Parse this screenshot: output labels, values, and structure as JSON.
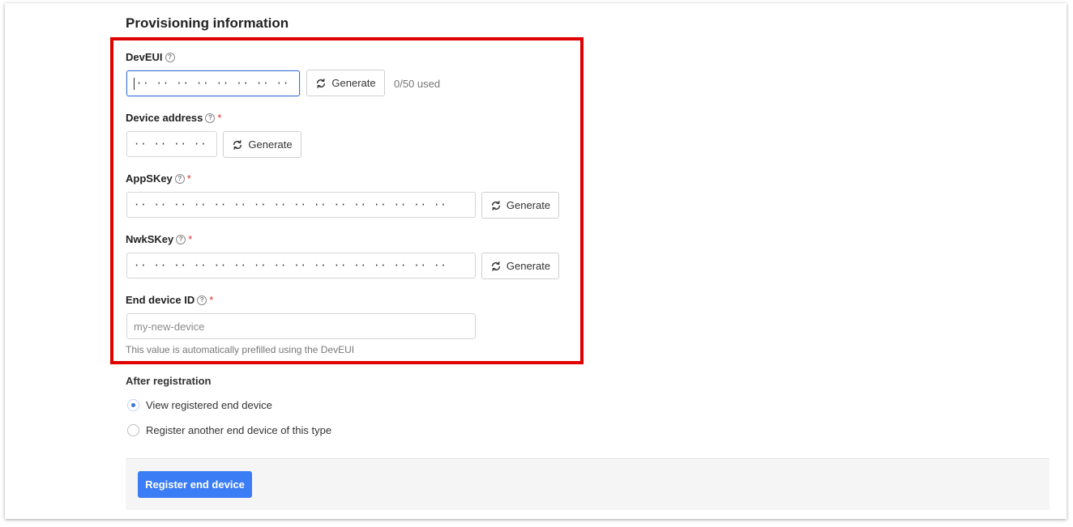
{
  "section": {
    "title": "Provisioning information"
  },
  "fields": {
    "deveui": {
      "label": "DevEUI",
      "value": "·· ·· ·· ·· ·· ·· ·· ··",
      "generate_label": "Generate",
      "usage": "0/50 used"
    },
    "device_address": {
      "label": "Device address",
      "required_mark": "*",
      "value": "·· ·· ·· ··",
      "generate_label": "Generate"
    },
    "appskey": {
      "label": "AppSKey",
      "required_mark": "*",
      "value": "·· ·· ·· ·· ·· ·· ·· ·· ·· ·· ·· ·· ·· ·· ·· ··",
      "generate_label": "Generate"
    },
    "nwkskey": {
      "label": "NwkSKey",
      "required_mark": "*",
      "value": "·· ·· ·· ·· ·· ·· ·· ·· ·· ·· ·· ·· ·· ·· ·· ··",
      "generate_label": "Generate"
    },
    "end_device_id": {
      "label": "End device ID",
      "required_mark": "*",
      "placeholder": "my-new-device",
      "helper": "This value is automatically prefilled using the DevEUI"
    }
  },
  "after_registration": {
    "label": "After registration",
    "options": [
      {
        "label": "View registered end device",
        "checked": true
      },
      {
        "label": "Register another end device of this type",
        "checked": false
      }
    ]
  },
  "submit": {
    "label": "Register end device"
  },
  "colors": {
    "highlight": "#e00000",
    "primary": "#3b7df4",
    "required": "#e0312a",
    "focus": "#3b74d6"
  },
  "icons": {
    "help": "question-circle-icon",
    "generate": "refresh-icon"
  }
}
